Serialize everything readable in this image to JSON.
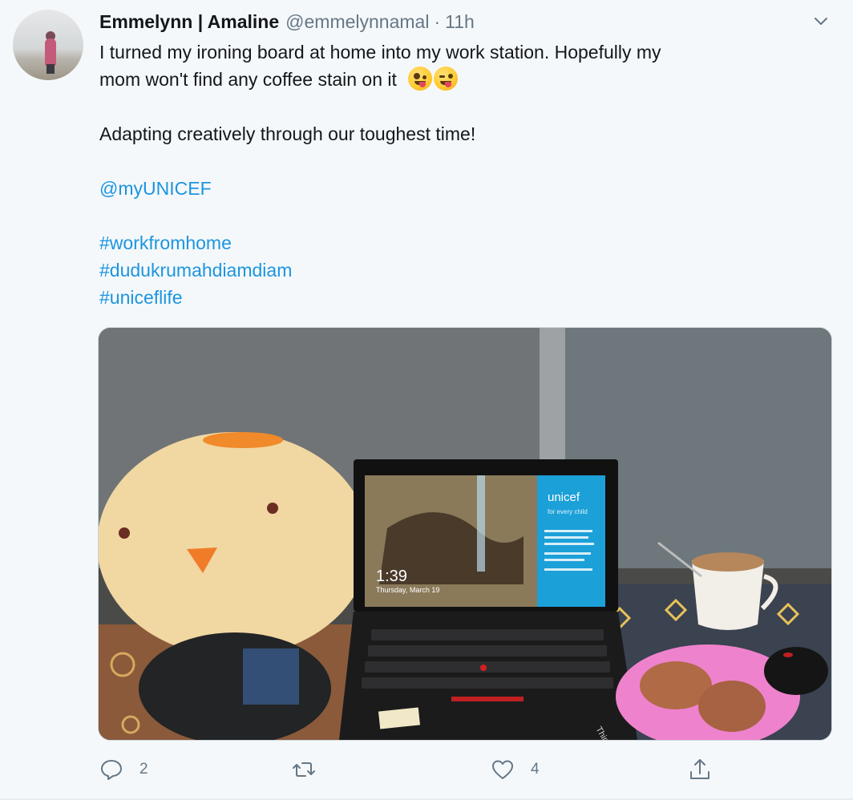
{
  "author": {
    "display_name": "Emmelynn | Amaline",
    "handle": "@emmelynnamal",
    "separator": "·",
    "time": "11h"
  },
  "tweet": {
    "line1": "I turned my ironing board at home into my work station. Hopefully my",
    "line2": "mom won't find any coffee stain on it",
    "line3": "Adapting creatively through our toughest time!",
    "mention": "@myUNICEF",
    "hashtags": [
      "#workfromhome",
      "#dudukrumahdiamdiam",
      "#uniceflife"
    ],
    "emojis": [
      "zany-face-emoji",
      "winking-face-with-tongue-emoji"
    ]
  },
  "media": {
    "laptop_brand": "unicef",
    "laptop_tagline": "for every child",
    "lock_time": "1:39",
    "lock_date": "Thursday, March 19",
    "laptop_model": "ThinkPad"
  },
  "actions": {
    "reply_count": "2",
    "retweet_count": "",
    "like_count": "4"
  },
  "icons": {
    "caret": "chevron-down-icon",
    "reply": "reply-icon",
    "retweet": "retweet-icon",
    "like": "heart-icon",
    "share": "share-icon"
  },
  "colors": {
    "link": "#1b95e0",
    "muted": "#657786",
    "text": "#14171a",
    "background": "#f5f8fa"
  }
}
